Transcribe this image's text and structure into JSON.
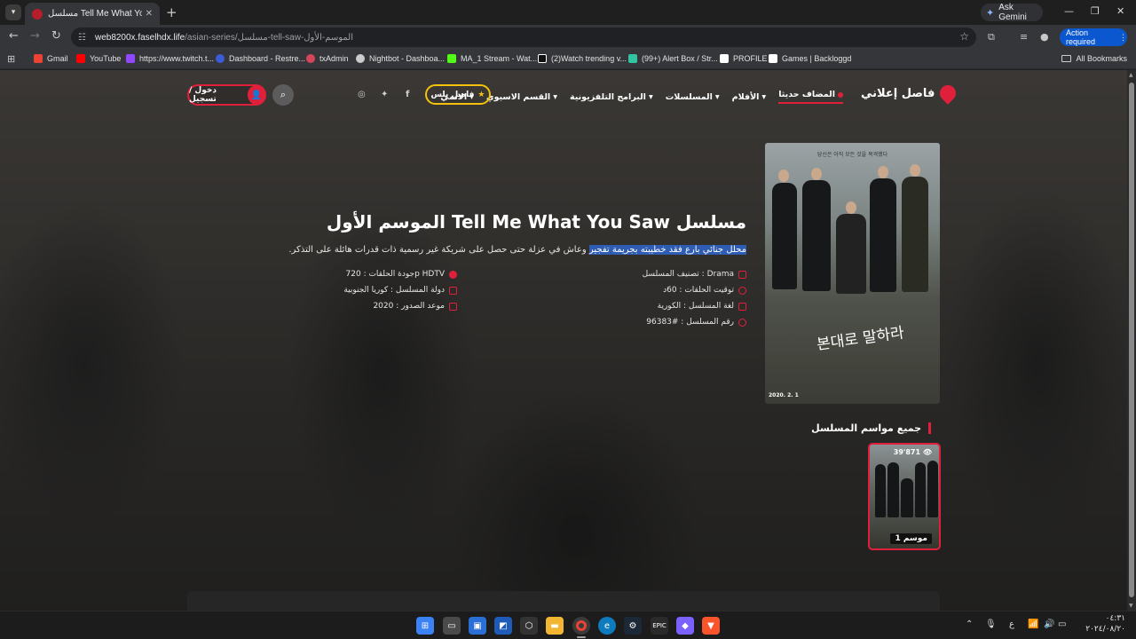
{
  "browser": {
    "tab_title": "مسلسل Tell Me What You Saw",
    "ask_gemini": "Ask Gemini",
    "url_host": "web8200x.faselhdx.life",
    "url_path": "/asian-series/مسلسل-tell-saw-الموسم-الأول",
    "action_required": "Action required",
    "bookmarks": [
      {
        "label": "Gmail",
        "color": "#ea4335"
      },
      {
        "label": "YouTube",
        "color": "#ff0000"
      },
      {
        "label": "https://www.twitch.t...",
        "color": "#9146ff"
      },
      {
        "label": "Dashboard - Restre...",
        "color": "#3c5bd6"
      },
      {
        "label": "txAdmin",
        "color": "#d6455c"
      },
      {
        "label": "Nightbot - Dashboa...",
        "color": "#cccccc"
      },
      {
        "label": "MA_1 Stream - Wat...",
        "color": "#53fc18"
      },
      {
        "label": "(2)Watch trending v...",
        "color": "#ffffff"
      },
      {
        "label": "(99+) Alert Box / Str...",
        "color": "#31c3a2"
      },
      {
        "label": "PROFILE",
        "color": "#ffffff"
      },
      {
        "label": "Games | Backloggd",
        "color": "#ffffff"
      }
    ],
    "all_bookmarks": "All Bookmarks"
  },
  "site": {
    "logo": "فاصل إعلاني",
    "menu": [
      "المضاف حديثا",
      "الأفلام",
      "المسلسلات",
      "البرامج التلفزيونية",
      "القسم الاسيوي",
      "الانمي"
    ],
    "plus_button": "فاصل بلس",
    "login": "دخول / تسجيل"
  },
  "show": {
    "title": "مسلسل Tell Me What You Saw الموسم الأول",
    "description_highlight": "محلل جنائي بارع فقد خطيبته بجريمة تفجير",
    "description_rest": " وعاش في عزلة حتى حصل على شريكة غير رسمية ذات قدرات هائلة على التذكر.",
    "info": {
      "genre": "تصنيف المسلسل : Drama",
      "duration": "توقيت الحلقات : 60د",
      "language": "لغة المسلسل : الكورية",
      "number": "رقم المسلسل : #96383",
      "quality": "جودة الحلقات : 720p HDTV",
      "country": "دولة المسلسل : كوريا الجنوبية",
      "year": "موعد الصدور : 2020"
    },
    "poster": {
      "tagline": "당신은 아직 모든 것을 목격했다",
      "title_korean": "본대로 말하라",
      "date": "2020. 2. 1"
    }
  },
  "seasons": {
    "heading": "جميع مواسم المسلسل",
    "items": [
      {
        "label": "موسم 1",
        "views": "39'871"
      }
    ]
  },
  "taskbar": {
    "time": "٠٤:٣١",
    "date": "٢٠٢٤/٠٨/٢٠",
    "lang": "ع"
  }
}
